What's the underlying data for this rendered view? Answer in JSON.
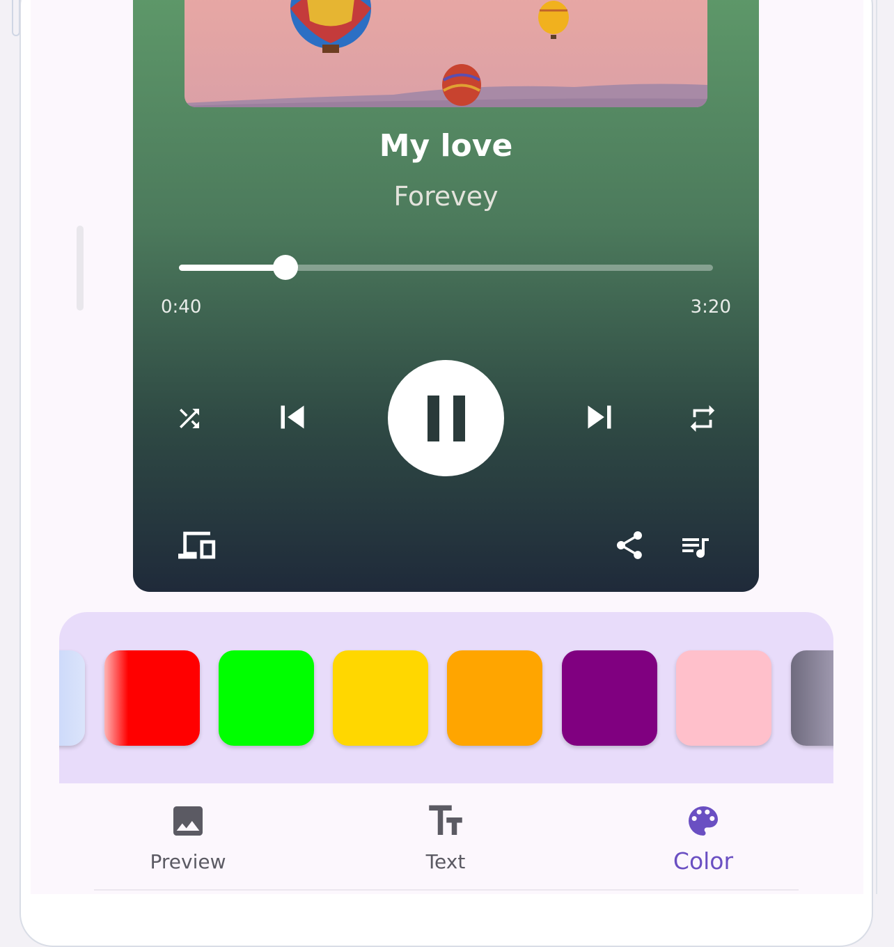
{
  "player": {
    "title": "My love",
    "artist": "Forevey",
    "elapsed": "0:40",
    "total": "3:20",
    "progress": 0.2
  },
  "icons": {
    "shuffle": "shuffle-icon",
    "previous": "skip-previous-icon",
    "pause": "pause-icon",
    "next": "skip-next-icon",
    "repeat": "repeat-icon",
    "devices": "devices-icon",
    "share": "share-icon",
    "queue": "queue-music-icon"
  },
  "colors": {
    "swatches": [
      "#c5d4f7",
      "#ff0000",
      "#00ff00",
      "#ffd700",
      "#ffa500",
      "#800080",
      "#ffc0cb",
      "#8e8a9e"
    ],
    "active_accent": "#6a4fc2"
  },
  "nav": {
    "items": [
      {
        "label": "Preview",
        "icon": "image-icon"
      },
      {
        "label": "Text",
        "icon": "text-fields-icon"
      },
      {
        "label": "Color",
        "icon": "palette-icon"
      }
    ],
    "active": "Color"
  }
}
